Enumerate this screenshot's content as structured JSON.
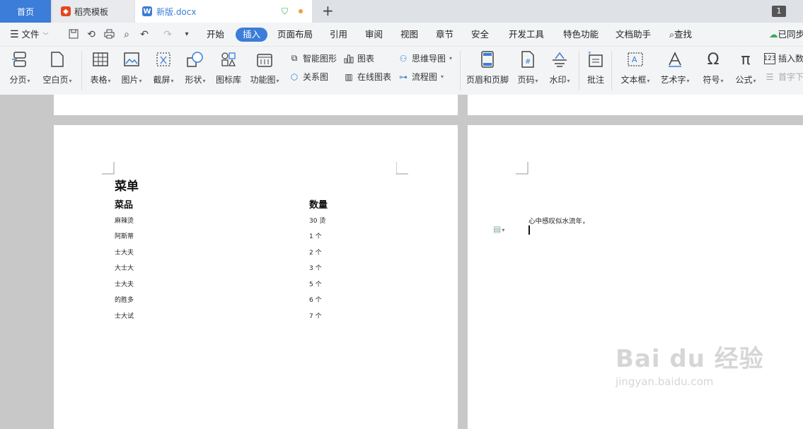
{
  "tabs": {
    "home": "首页",
    "templates": "稻壳模板",
    "doc": "新版.docx",
    "new_tab": "+",
    "page_count": "1"
  },
  "menu": {
    "file": "文件",
    "items": [
      "开始",
      "插入",
      "页面布局",
      "引用",
      "审阅",
      "视图",
      "章节",
      "安全",
      "开发工具",
      "特色功能",
      "文档助手"
    ],
    "search": "查找",
    "sync": "已同步"
  },
  "ribbon": {
    "page_break": "分页",
    "blank_page": "空白页",
    "table": "表格",
    "picture": "图片",
    "screenshot": "截屏",
    "shape": "形状",
    "icon_lib": "图标库",
    "func_chart": "功能图",
    "smart_shape": "智能图形",
    "chart": "图表",
    "mindmap": "思维导图",
    "relation": "关系图",
    "online_chart": "在线图表",
    "flowchart": "流程图",
    "header_footer": "页眉和页脚",
    "page_num": "页码",
    "watermark": "水印",
    "comment": "批注",
    "textbox": "文本框",
    "wordart": "艺术字",
    "symbol": "符号",
    "formula": "公式",
    "insert_num": "插入数",
    "drop_cap": "首字下"
  },
  "doc": {
    "title": "菜单",
    "col1": "菜品",
    "col2": "数量",
    "rows": [
      {
        "name": "麻辣烫",
        "qty": "30 烫"
      },
      {
        "name": "阿斯蒂",
        "qty": "1 个"
      },
      {
        "name": "士大夫",
        "qty": "2 个"
      },
      {
        "name": "大士大",
        "qty": "3 个"
      },
      {
        "name": "士大夫",
        "qty": "5 个"
      },
      {
        "name": "的胜多",
        "qty": "6 个"
      },
      {
        "name": "士大试",
        "qty": "7 个"
      }
    ],
    "page2_text": "心中感叹似水流年，"
  },
  "watermark": {
    "big": "Bai du 经验",
    "small": "jingyan.baidu.com"
  },
  "colors": {
    "accent": "#3b7dd8",
    "tabbar": "#dee1e6",
    "ribbon": "#f3f4f6",
    "canvas": "#c8c8c8"
  }
}
